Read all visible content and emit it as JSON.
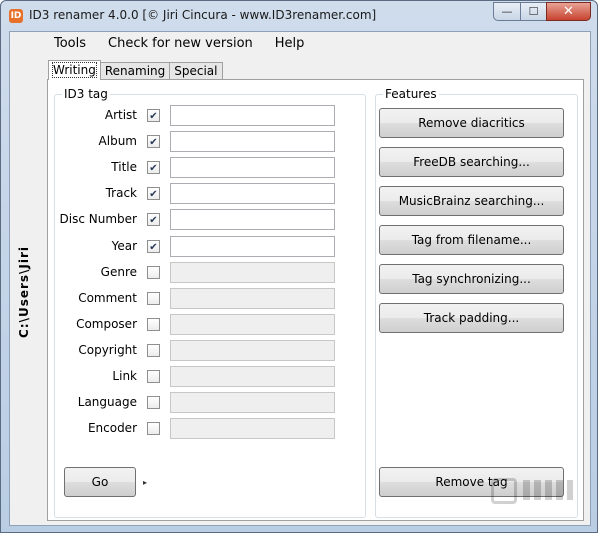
{
  "window": {
    "title": "ID3 renamer 4.0.0 [© Jiri Cincura - www.ID3renamer.com]",
    "app_icon": "ID",
    "minimize": "—",
    "maximize": "☐",
    "close": "✕"
  },
  "side_path": "C:\\Users\\Jiri",
  "menu": {
    "tools": "Tools",
    "check_updates": "Check for new version",
    "help": "Help"
  },
  "tabs": [
    "Writing",
    "Renaming",
    "Special"
  ],
  "id3": {
    "legend": "ID3 tag",
    "fields": [
      {
        "label": "Artist",
        "checked": true,
        "value": ""
      },
      {
        "label": "Album",
        "checked": true,
        "value": ""
      },
      {
        "label": "Title",
        "checked": true,
        "value": ""
      },
      {
        "label": "Track",
        "checked": true,
        "value": ""
      },
      {
        "label": "Disc Number",
        "checked": true,
        "value": ""
      },
      {
        "label": "Year",
        "checked": true,
        "value": ""
      },
      {
        "label": "Genre",
        "checked": false,
        "value": ""
      },
      {
        "label": "Comment",
        "checked": false,
        "value": ""
      },
      {
        "label": "Composer",
        "checked": false,
        "value": ""
      },
      {
        "label": "Copyright",
        "checked": false,
        "value": ""
      },
      {
        "label": "Link",
        "checked": false,
        "value": ""
      },
      {
        "label": "Language",
        "checked": false,
        "value": ""
      },
      {
        "label": "Encoder",
        "checked": false,
        "value": ""
      }
    ],
    "go": "Go",
    "go_arrow": "▸"
  },
  "features": {
    "legend": "Features",
    "buttons": [
      "Remove diacritics",
      "FreeDB searching...",
      "MusicBrainz searching...",
      "Tag from filename...",
      "Tag synchronizing...",
      "Track padding..."
    ],
    "remove_tag": "Remove tag"
  }
}
